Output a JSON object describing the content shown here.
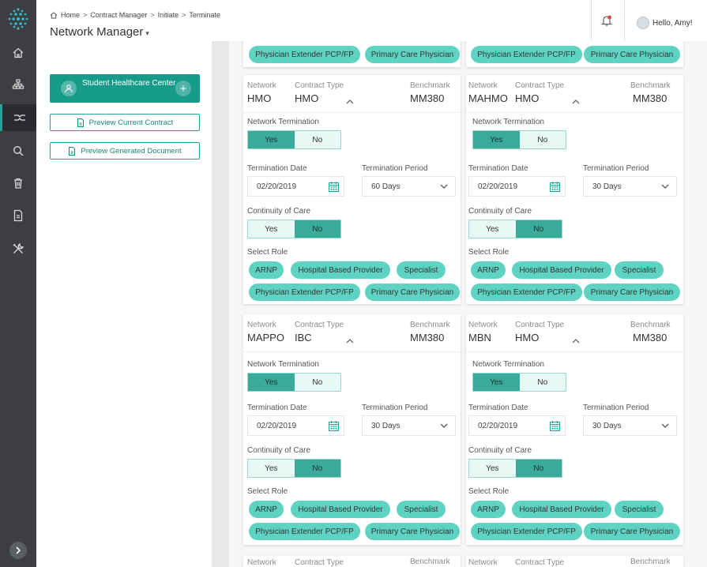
{
  "header": {
    "breadcrumb": [
      "Home",
      "Contract Manager",
      "Initiate",
      "Terminate"
    ],
    "page_title": "Network Manager",
    "greeting": "Hello, Amy!"
  },
  "sidebar": {
    "icons": [
      "home-icon",
      "hierarchy-icon",
      "network-icon",
      "search-icon",
      "trash-icon",
      "document-icon",
      "tools-icon"
    ],
    "active_index": 2
  },
  "left_panel": {
    "center_name": "Student Healthcare Center",
    "preview_contract_label": "Preview Current Contract",
    "preview_document_label": "Preview Generated Document"
  },
  "labels": {
    "network": "Network",
    "contract_type": "Contract Type",
    "benchmark": "Benchmark",
    "network_termination": "Network Termination",
    "termination_date": "Termination Date",
    "termination_period": "Termination Period",
    "continuity_of_care": "Continuity of Care",
    "select_role": "Select Role",
    "yes": "Yes",
    "no": "No"
  },
  "roles": [
    "ARNP",
    "Hospital Based Provider",
    "Specialist",
    "Physician Extender PCP/FP",
    "Primary Care Physician"
  ],
  "cards": [
    {
      "network": "HMO",
      "contract_type": "HMO",
      "benchmark": "MM380",
      "network_termination": "Yes",
      "termination_date": "02/20/2019",
      "termination_period": "60 Days",
      "continuity_of_care": "No"
    },
    {
      "network": "MAHMO",
      "contract_type": "HMO",
      "benchmark": "MM380",
      "network_termination": "Yes",
      "termination_date": "02/20/2019",
      "termination_period": "30 Days",
      "continuity_of_care": "No"
    },
    {
      "network": "MAPPO",
      "contract_type": "IBC",
      "benchmark": "MM380",
      "network_termination": "Yes",
      "termination_date": "02/20/2019",
      "termination_period": "30 Days",
      "continuity_of_care": "No"
    },
    {
      "network": "MBN",
      "contract_type": "HMO",
      "benchmark": "MM380",
      "network_termination": "Yes",
      "termination_date": "02/20/2019",
      "termination_period": "30 Days",
      "continuity_of_care": "No"
    }
  ],
  "colors": {
    "accent": "#169b8a",
    "chip": "#5fd3c1",
    "rail": "#3c3e42"
  }
}
